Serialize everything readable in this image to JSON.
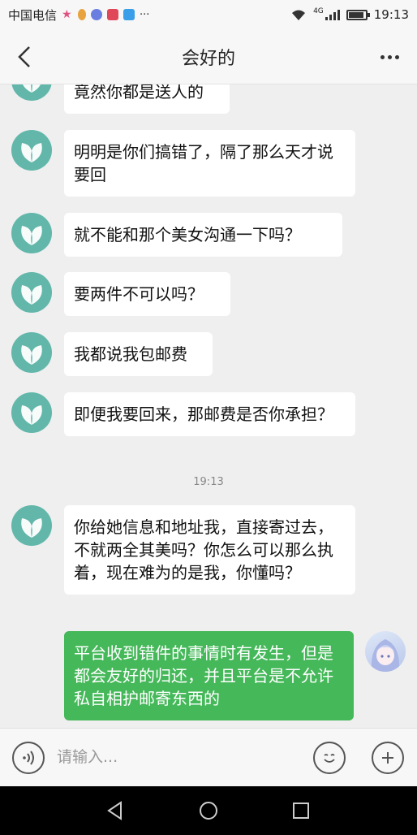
{
  "status": {
    "carrier": "中国电信",
    "more": "···",
    "network": "4G",
    "time": "19:13"
  },
  "header": {
    "title": "会好的"
  },
  "messages": [
    {
      "text": "竟然你都是送人的"
    },
    {
      "text": "明明是你们搞错了，隔了那么天才说要回"
    },
    {
      "text": "就不能和那个美女沟通一下吗？"
    },
    {
      "text": "要两件不可以吗？"
    },
    {
      "text": "我都说我包邮费"
    },
    {
      "text": "即便我要回来，那邮费是否你承担？"
    },
    {
      "text": "你给她信息和地址我，直接寄过去，不就两全其美吗？你怎么可以那么执着，现在难为的是我，你懂吗？"
    },
    {
      "text": "平台收到错件的事情时有发生，但是都会友好的归还，并且平台是不允许私自相护邮寄东西的"
    }
  ],
  "timestamp": "19:13",
  "input": {
    "placeholder": "请输入..."
  },
  "colors": {
    "outgoing": "#45b85a",
    "avatar": "#62b7aa"
  },
  "battery_level": 0.9
}
